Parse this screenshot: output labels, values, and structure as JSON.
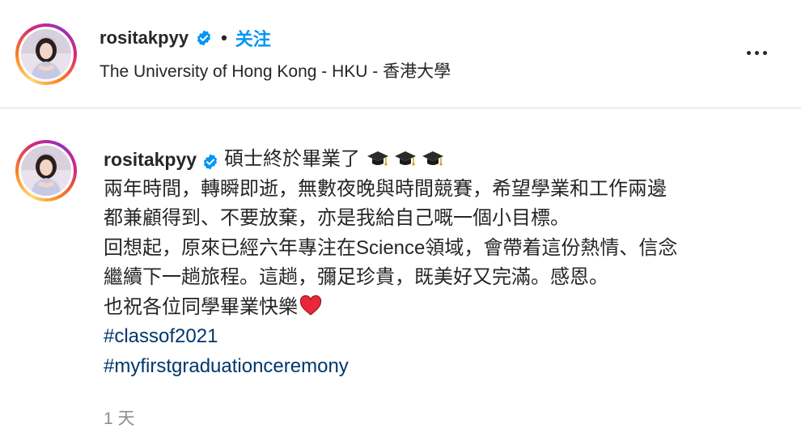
{
  "header": {
    "username": "rositakpyy",
    "separator": "•",
    "follow_label": "关注",
    "location": "The University of Hong Kong - HKU - 香港大學",
    "verified_icon": "verified-badge-icon",
    "more_icon": "more-options-icon"
  },
  "caption": {
    "username": "rositakpyy",
    "first_line_text": "碩士終於畢業了",
    "emoji_icons": [
      "graduation-cap-icon",
      "graduation-cap-icon",
      "graduation-cap-icon"
    ],
    "lines": [
      "兩年時間，轉瞬即逝，無數夜晚與時間競賽，希望學業和工作兩邊",
      "都兼顧得到、不要放棄，亦是我給自己嘅一個小目標。",
      "回想起，原來已經六年專注在Science領域，會帶着這份熱情、信念",
      "繼續下一趟旅程。這趟，彌足珍貴，既美好又完滿。感恩。"
    ],
    "last_line_text": "也祝各位同學畢業快樂",
    "heart_icon": "red-heart-icon",
    "hashtags": [
      "#classof2021",
      "#myfirstgraduationceremony"
    ],
    "timestamp": "1 天"
  },
  "colors": {
    "link_blue": "#0095f6",
    "hashtag_blue": "#00376b",
    "verified_blue": "#0095f6",
    "muted_gray": "#8e8e8e",
    "heart_red": "#e8283a"
  }
}
